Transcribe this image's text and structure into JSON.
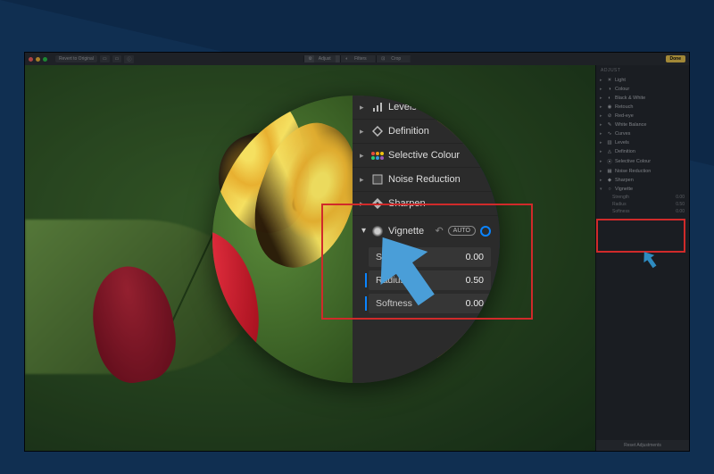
{
  "toolbar": {
    "revert_label": "Revert to Original",
    "tabs": [
      "Adjust",
      "Filters",
      "Crop"
    ],
    "active_tab": 0,
    "done_label": "Done"
  },
  "sidebar": {
    "header": "ADJUST",
    "items": [
      {
        "icon": "☀",
        "label": "Light"
      },
      {
        "icon": "◑",
        "label": "Colour"
      },
      {
        "icon": "◐",
        "label": "Black & White"
      },
      {
        "icon": "◉",
        "label": "Retouch"
      },
      {
        "icon": "⊘",
        "label": "Red-eye"
      },
      {
        "icon": "✎",
        "label": "White Balance"
      },
      {
        "icon": "∿",
        "label": "Curves"
      },
      {
        "icon": "▥",
        "label": "Levels"
      },
      {
        "icon": "◬",
        "label": "Definition"
      },
      {
        "icon": "⦿",
        "label": "Selective Colour"
      },
      {
        "icon": "▦",
        "label": "Noise Reduction"
      },
      {
        "icon": "◆",
        "label": "Sharpen"
      },
      {
        "icon": "○",
        "label": "Vignette"
      }
    ],
    "vignette_params": [
      {
        "name": "Strength",
        "value": "0.00"
      },
      {
        "name": "Radius",
        "value": "0.50"
      },
      {
        "name": "Softness",
        "value": "0.00"
      }
    ],
    "footer": "Reset Adjustments"
  },
  "zoom": {
    "items": [
      {
        "label": "Levels"
      },
      {
        "label": "Definition"
      },
      {
        "label": "Selective Colour"
      },
      {
        "label": "Noise Reduction"
      },
      {
        "label": "Sharpen"
      }
    ],
    "section": {
      "title": "Vignette",
      "auto": "AUTO",
      "params": [
        {
          "name": "Strength",
          "value": "0.00"
        },
        {
          "name": "Radius",
          "value": "0.50"
        },
        {
          "name": "Softness",
          "value": "0.00"
        }
      ]
    }
  }
}
